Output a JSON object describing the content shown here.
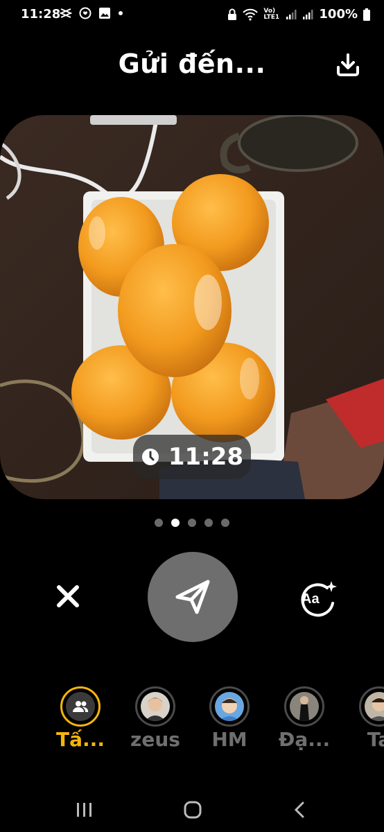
{
  "status_bar": {
    "time": "11:28",
    "battery": "100%",
    "network": "Vo) LTE1"
  },
  "header": {
    "title": "Gửi đến..."
  },
  "photo": {
    "timestamp": "11:28"
  },
  "pager": {
    "count": 5,
    "active_index": 1
  },
  "controls": {
    "close_icon": "close-icon",
    "send_icon": "send-icon",
    "text_icon": "text-style-icon",
    "text_icon_label": "Aa"
  },
  "recipients": [
    {
      "label": "Tấ...",
      "selected": true
    },
    {
      "label": "zeus",
      "selected": false
    },
    {
      "label": "HM",
      "selected": false
    },
    {
      "label": "Đạ...",
      "selected": false
    },
    {
      "label": "Ta",
      "selected": false
    }
  ],
  "colors": {
    "accent": "#f5b50c",
    "send_button": "#6e6e6e",
    "background": "#000000"
  }
}
